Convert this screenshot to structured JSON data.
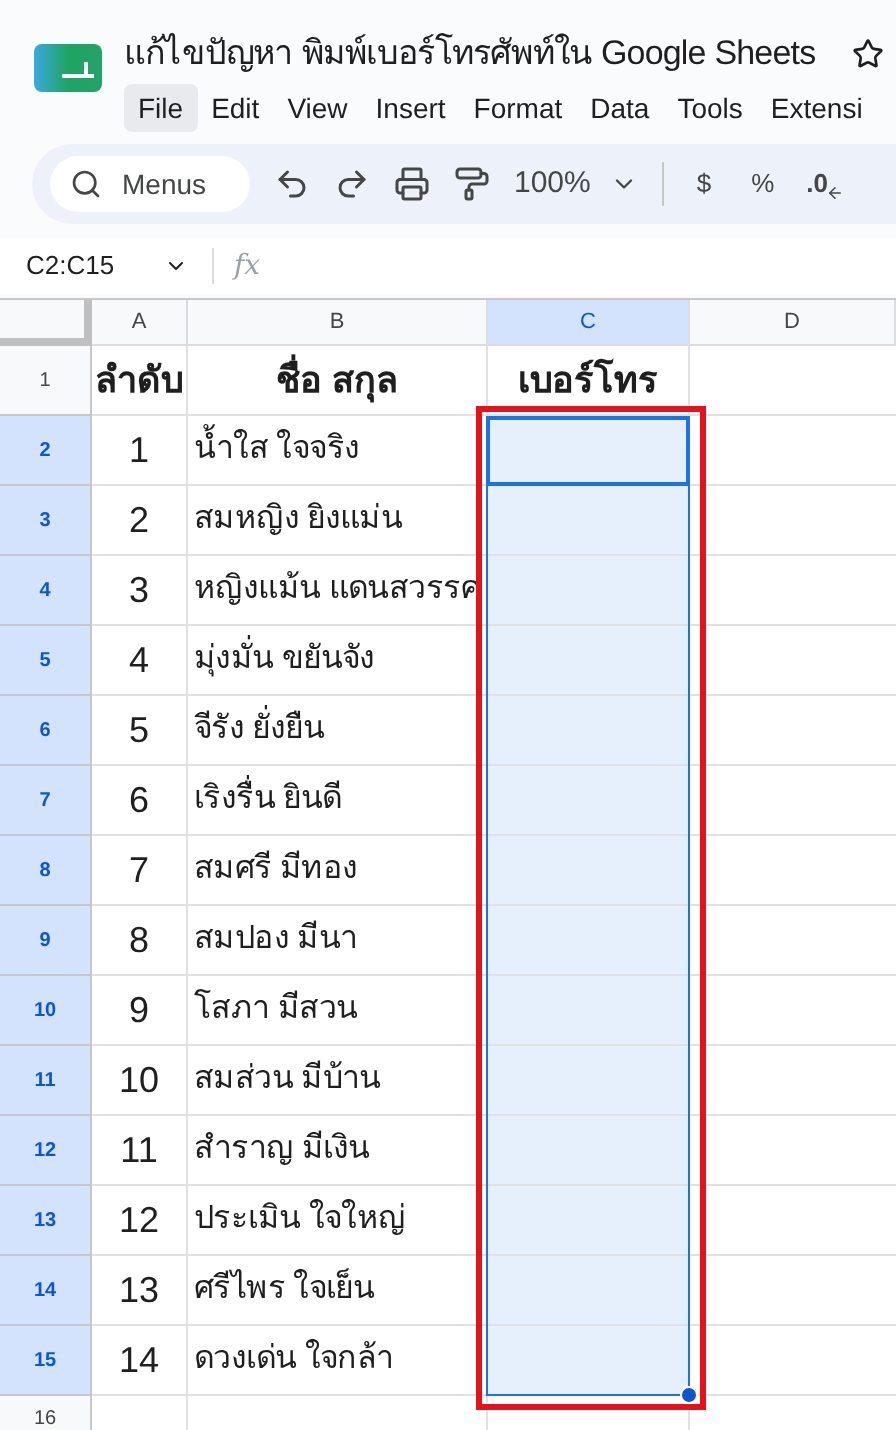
{
  "document": {
    "title": "แก้ไขปัญหา พิมพ์เบอร์โทรศัพท์ใน Google Sheets"
  },
  "menu": [
    {
      "label": "File",
      "selected": true
    },
    {
      "label": "Edit",
      "selected": false
    },
    {
      "label": "View",
      "selected": false
    },
    {
      "label": "Insert",
      "selected": false
    },
    {
      "label": "Format",
      "selected": false
    },
    {
      "label": "Data",
      "selected": false
    },
    {
      "label": "Tools",
      "selected": false
    },
    {
      "label": "Extensi",
      "selected": false
    }
  ],
  "toolbar": {
    "search": "Menus",
    "zoom": "100%",
    "currency": "$",
    "percent": "%",
    "decimal": ".0"
  },
  "formula_bar": {
    "name_box": "C2:C15",
    "fx": "fx"
  },
  "columns": [
    {
      "label": "A",
      "selected": false
    },
    {
      "label": "B",
      "selected": false
    },
    {
      "label": "C",
      "selected": true
    },
    {
      "label": "D",
      "selected": false
    }
  ],
  "rows": [
    {
      "number": "1",
      "selected": false,
      "cells": [
        "ลำดับ",
        "ชื่อ สกุล",
        "เบอร์โทร"
      ]
    },
    {
      "number": "2",
      "selected": true,
      "cells": [
        "1",
        "น้ำใส ใจจริง",
        ""
      ]
    },
    {
      "number": "3",
      "selected": true,
      "cells": [
        "2",
        "สมหญิง ยิงแม่น",
        ""
      ]
    },
    {
      "number": "4",
      "selected": true,
      "cells": [
        "3",
        "หญิงแม้น แดนสวรรค",
        ""
      ]
    },
    {
      "number": "5",
      "selected": true,
      "cells": [
        "4",
        "มุ่งมั่น ขยันจัง",
        ""
      ]
    },
    {
      "number": "6",
      "selected": true,
      "cells": [
        "5",
        "จีรัง ยั่งยืน",
        ""
      ]
    },
    {
      "number": "7",
      "selected": true,
      "cells": [
        "6",
        "เริงรื่น ยินดี",
        ""
      ]
    },
    {
      "number": "8",
      "selected": true,
      "cells": [
        "7",
        "สมศรี มีทอง",
        ""
      ]
    },
    {
      "number": "9",
      "selected": true,
      "cells": [
        "8",
        "สมปอง มีนา",
        ""
      ]
    },
    {
      "number": "10",
      "selected": true,
      "cells": [
        "9",
        "โสภา มีสวน",
        ""
      ]
    },
    {
      "number": "11",
      "selected": true,
      "cells": [
        "10",
        "สมส่วน มีบ้าน",
        ""
      ]
    },
    {
      "number": "12",
      "selected": true,
      "cells": [
        "11",
        "สำราญ มีเงิน",
        ""
      ]
    },
    {
      "number": "13",
      "selected": true,
      "cells": [
        "12",
        "ประเมิน ใจใหญ่",
        ""
      ]
    },
    {
      "number": "14",
      "selected": true,
      "cells": [
        "13",
        "ศรีไพร ใจเย็น",
        ""
      ]
    },
    {
      "number": "15",
      "selected": true,
      "cells": [
        "14",
        "ดวงเด่น ใจกล้า",
        ""
      ]
    },
    {
      "number": "16",
      "selected": false,
      "cells": [
        "",
        "",
        ""
      ]
    }
  ]
}
